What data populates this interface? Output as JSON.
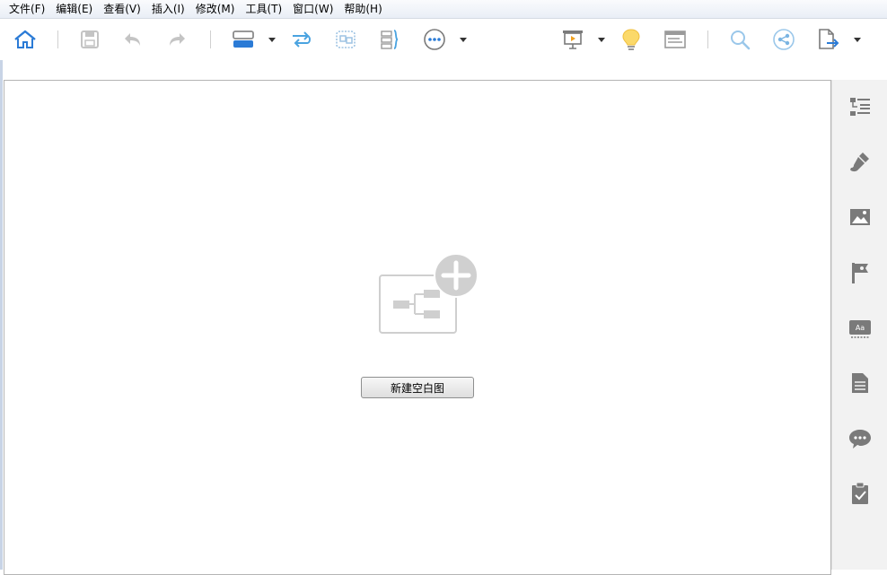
{
  "menu": {
    "items": [
      "文件(F)",
      "编辑(E)",
      "查看(V)",
      "插入(I)",
      "修改(M)",
      "工具(T)",
      "窗口(W)",
      "帮助(H)"
    ]
  },
  "toolbar": {
    "icons": [
      "home-icon",
      "save-icon",
      "undo-icon",
      "redo-icon",
      "topic-layout-icon",
      "relationship-icon",
      "boundary-icon",
      "summary-icon",
      "more-icon",
      "presentation-icon",
      "idea-icon",
      "outline-icon",
      "search-icon",
      "share-icon",
      "export-icon"
    ]
  },
  "sidebar": {
    "icons": [
      "outline-panel-icon",
      "format-brush-icon",
      "image-icon",
      "marker-flag-icon",
      "text-style-icon",
      "notes-icon",
      "comment-icon",
      "task-clipboard-icon"
    ]
  },
  "empty_state": {
    "button_label": "新建空白图"
  },
  "colors": {
    "accent": "#2b7bd6",
    "icon_gray": "#7a7a7a",
    "sidebar_bg": "#f2f2f2"
  }
}
